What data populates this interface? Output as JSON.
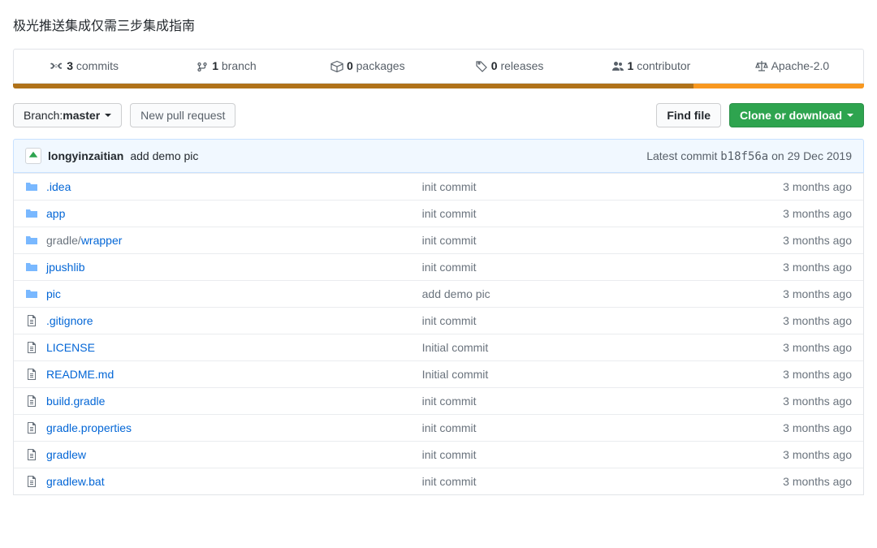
{
  "repo": {
    "description": "极光推送集成仅需三步集成指南"
  },
  "stats": {
    "commits_count": "3",
    "commits_label": "commits",
    "branches_count": "1",
    "branches_label": "branch",
    "packages_count": "0",
    "packages_label": "packages",
    "releases_count": "0",
    "releases_label": "releases",
    "contributors_count": "1",
    "contributors_label": "contributor",
    "license": "Apache-2.0"
  },
  "toolbar": {
    "branch_prefix": "Branch: ",
    "branch_name": "master",
    "new_pr": "New pull request",
    "find_file": "Find file",
    "clone": "Clone or download"
  },
  "latest_commit": {
    "author": "longyinzaitian",
    "message": "add demo pic",
    "prefix": "Latest commit ",
    "sha": "b18f56a",
    "date": " on 29 Dec 2019"
  },
  "files": [
    {
      "type": "dir",
      "name": ".idea",
      "path_html": ".idea",
      "msg": "init commit",
      "time": "3 months ago"
    },
    {
      "type": "dir",
      "name": "app",
      "path_html": "app",
      "msg": "init commit",
      "time": "3 months ago"
    },
    {
      "type": "dir",
      "name": "gradle/wrapper",
      "path_html": "gradle/<span class='file-link'>wrapper</span>",
      "prefix": "gradle/",
      "leaf": "wrapper",
      "msg": "init commit",
      "time": "3 months ago"
    },
    {
      "type": "dir",
      "name": "jpushlib",
      "path_html": "jpushlib",
      "msg": "init commit",
      "time": "3 months ago"
    },
    {
      "type": "dir",
      "name": "pic",
      "path_html": "pic",
      "msg": "add demo pic",
      "time": "3 months ago"
    },
    {
      "type": "file",
      "name": ".gitignore",
      "path_html": ".gitignore",
      "msg": "init commit",
      "time": "3 months ago"
    },
    {
      "type": "file",
      "name": "LICENSE",
      "path_html": "LICENSE",
      "msg": "Initial commit",
      "time": "3 months ago"
    },
    {
      "type": "file",
      "name": "README.md",
      "path_html": "README.md",
      "msg": "Initial commit",
      "time": "3 months ago"
    },
    {
      "type": "file",
      "name": "build.gradle",
      "path_html": "build.gradle",
      "msg": "init commit",
      "time": "3 months ago"
    },
    {
      "type": "file",
      "name": "gradle.properties",
      "path_html": "gradle.properties",
      "msg": "init commit",
      "time": "3 months ago"
    },
    {
      "type": "file",
      "name": "gradlew",
      "path_html": "gradlew",
      "msg": "init commit",
      "time": "3 months ago"
    },
    {
      "type": "file",
      "name": "gradlew.bat",
      "path_html": "gradlew.bat",
      "msg": "init commit",
      "time": "3 months ago"
    }
  ]
}
